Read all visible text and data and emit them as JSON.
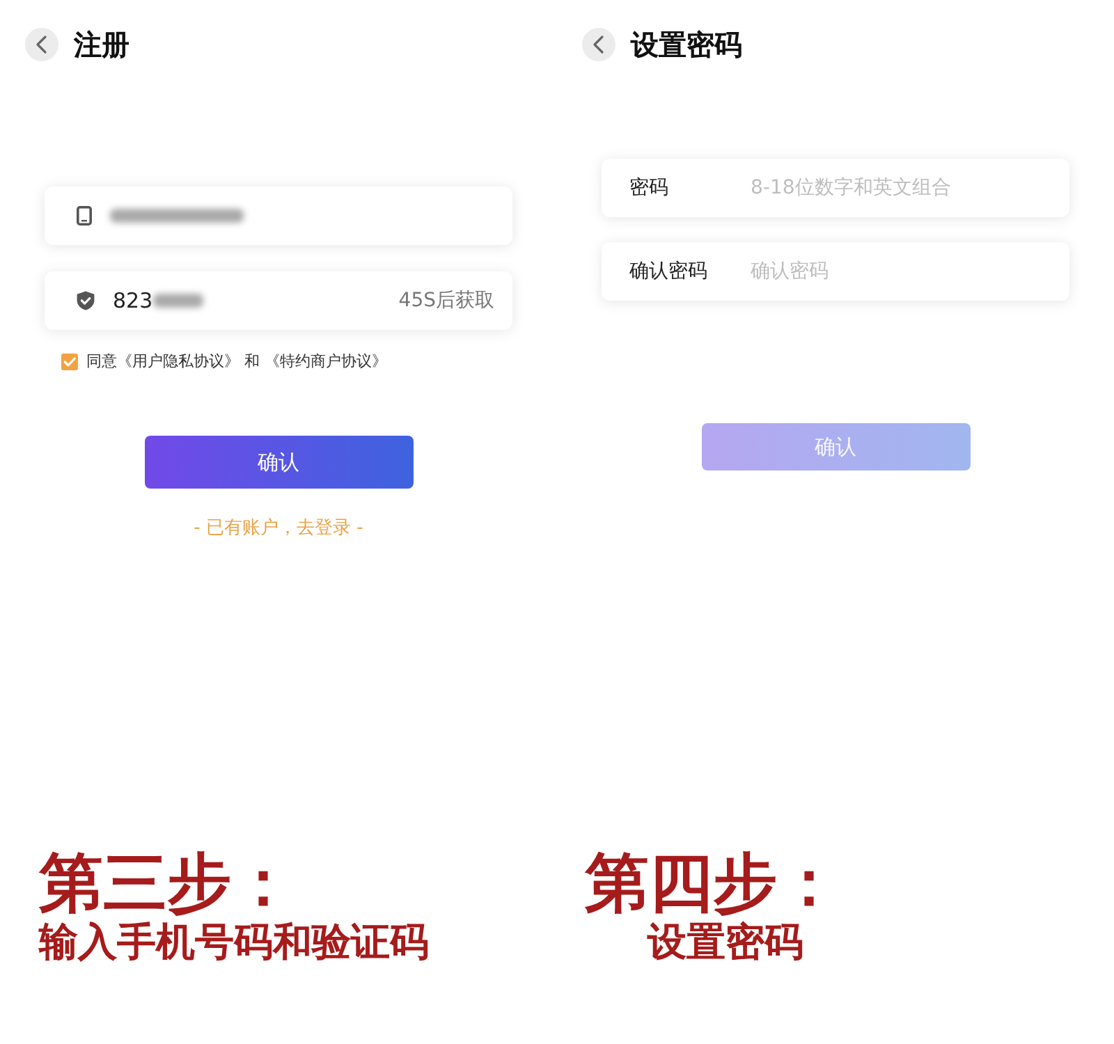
{
  "register": {
    "title": "注册",
    "fields": [
      {
        "kind": "phone",
        "obscured": true
      },
      {
        "kind": "code",
        "value": "823",
        "obscured": true,
        "action": "45S后获取"
      }
    ],
    "agreement": {
      "checked": true,
      "text": "同意《用户隐私协议》 和 《特约商户协议》"
    },
    "confirm_button": {
      "label": "确认",
      "disabled": false
    },
    "login_link": "- 已有账户，去登录 -"
  },
  "set_password": {
    "title": "设置密码",
    "fields": [
      {
        "label": "密码",
        "placeholder": "8-18位数字和英文组合"
      },
      {
        "label": "确认密码",
        "placeholder": "确认密码"
      }
    ],
    "confirm_button": {
      "label": "确认",
      "disabled": true
    }
  },
  "captions": [
    {
      "step": "第三步：",
      "description": "输入手机号码和验证码"
    },
    {
      "step": "第四步：",
      "description": "设置密码"
    }
  ]
}
